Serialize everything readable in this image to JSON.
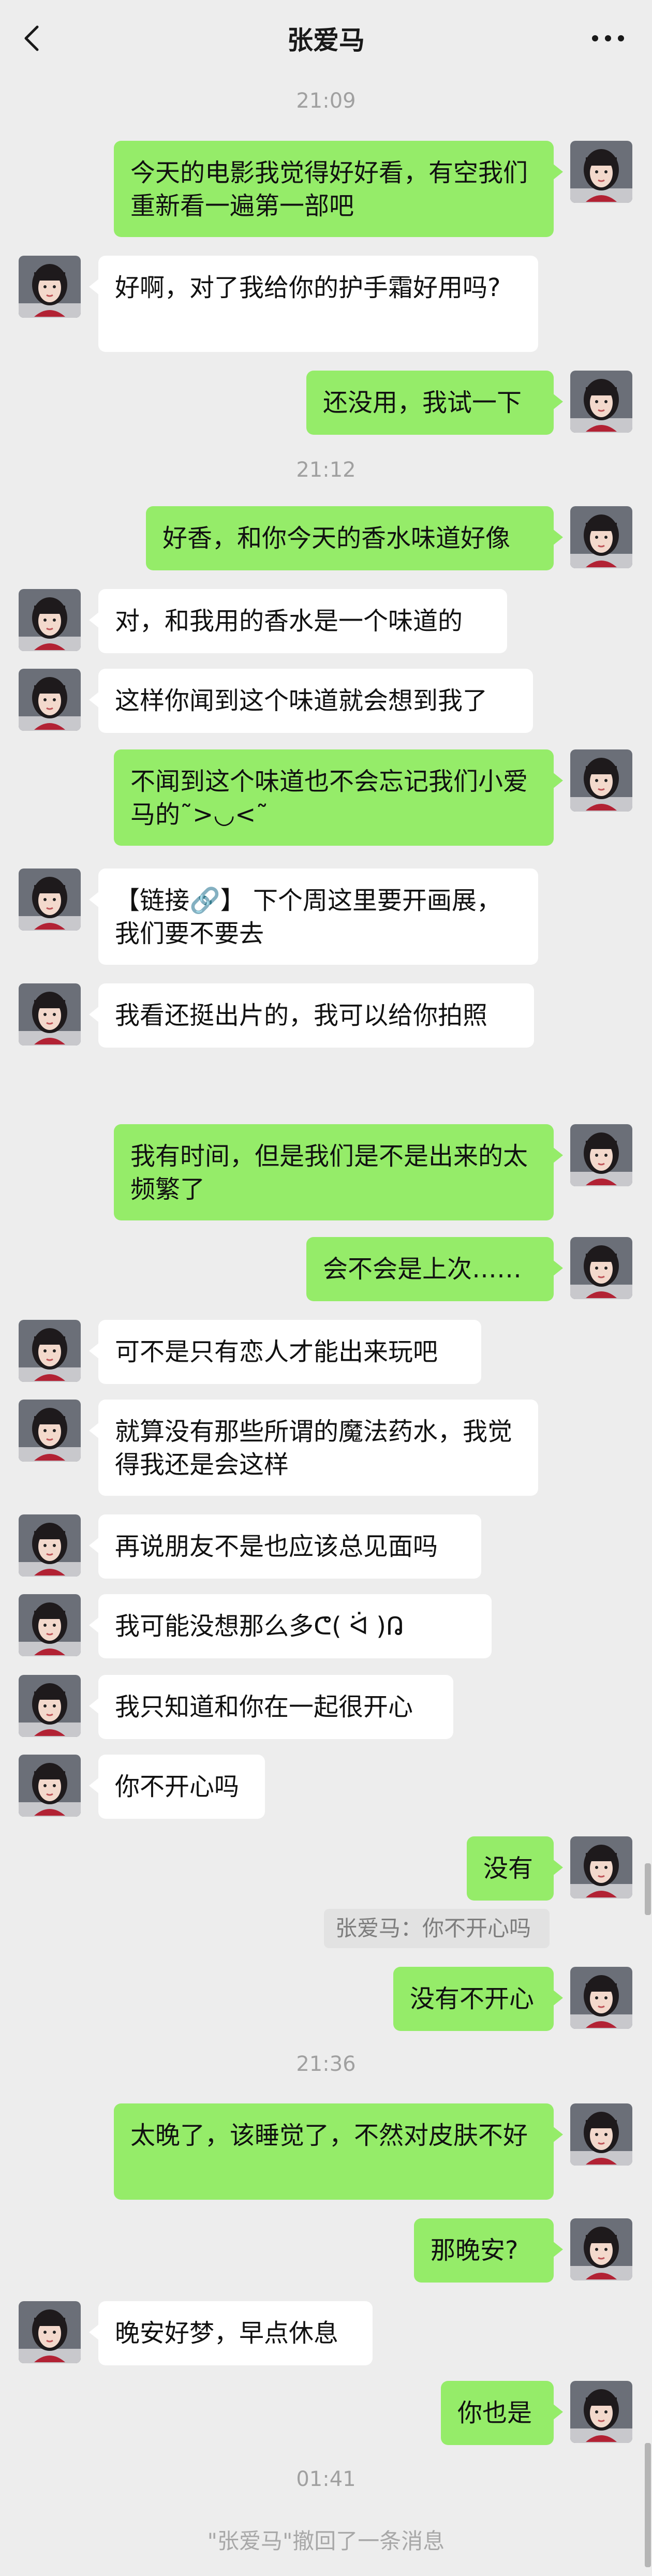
{
  "header": {
    "title": "张爱马",
    "back_icon": "chevron-left-icon",
    "more_icon": "more-dots-icon"
  },
  "timestamps": [
    "21:09",
    "21:12",
    "21:36",
    "01:41"
  ],
  "messages": [
    {
      "side": "right",
      "text": "今天的电影我觉得好好看，有空我们重新看一遍第一部吧"
    },
    {
      "side": "left",
      "text": "好啊，对了我给你的护手霜好用吗?"
    },
    {
      "side": "right",
      "text": "还没用，我试一下"
    },
    {
      "side": "right",
      "text": "好香，和你今天的香水味道好像"
    },
    {
      "side": "left",
      "text": "对，和我用的香水是一个味道的"
    },
    {
      "side": "left",
      "text": "这样你闻到这个味道就会想到我了"
    },
    {
      "side": "right",
      "text": "不闻到这个味道也不会忘记我们小爱马的˜>◡<˜"
    },
    {
      "side": "left",
      "text": "【链接🔗】 下个周这里要开画展，我们要不要去"
    },
    {
      "side": "left",
      "text": "我看还挺出片的，我可以给你拍照"
    },
    {
      "side": "right",
      "text": "我有时间，但是我们是不是出来的太频繁了"
    },
    {
      "side": "right",
      "text": "会不会是上次……"
    },
    {
      "side": "left",
      "text": "可不是只有恋人才能出来玩吧"
    },
    {
      "side": "left",
      "text": "就算没有那些所谓的魔法药水，我觉得我还是会这样"
    },
    {
      "side": "left",
      "text": "再说朋友不是也应该总见面吗"
    },
    {
      "side": "left",
      "text": "我可能没想那么多ᕦ( ᐛ )ᕡ"
    },
    {
      "side": "left",
      "text": "我只知道和你在一起很开心"
    },
    {
      "side": "left",
      "text": "你不开心吗"
    },
    {
      "side": "right",
      "text": "没有"
    },
    {
      "side": "right",
      "text": "没有不开心"
    },
    {
      "side": "right",
      "text": "太晚了，该睡觉了，不然对皮肤不好"
    },
    {
      "side": "right",
      "text": "那晚安?"
    },
    {
      "side": "left",
      "text": "晚安好梦，早点休息"
    },
    {
      "side": "right",
      "text": "你也是"
    }
  ],
  "quote": {
    "text": "张爱马：你不开心吗"
  },
  "recall": {
    "text": "\"张爱马\"撤回了一条消息"
  },
  "colors": {
    "background": "#ededed",
    "self_bubble": "#95ec69",
    "other_bubble": "#ffffff"
  }
}
